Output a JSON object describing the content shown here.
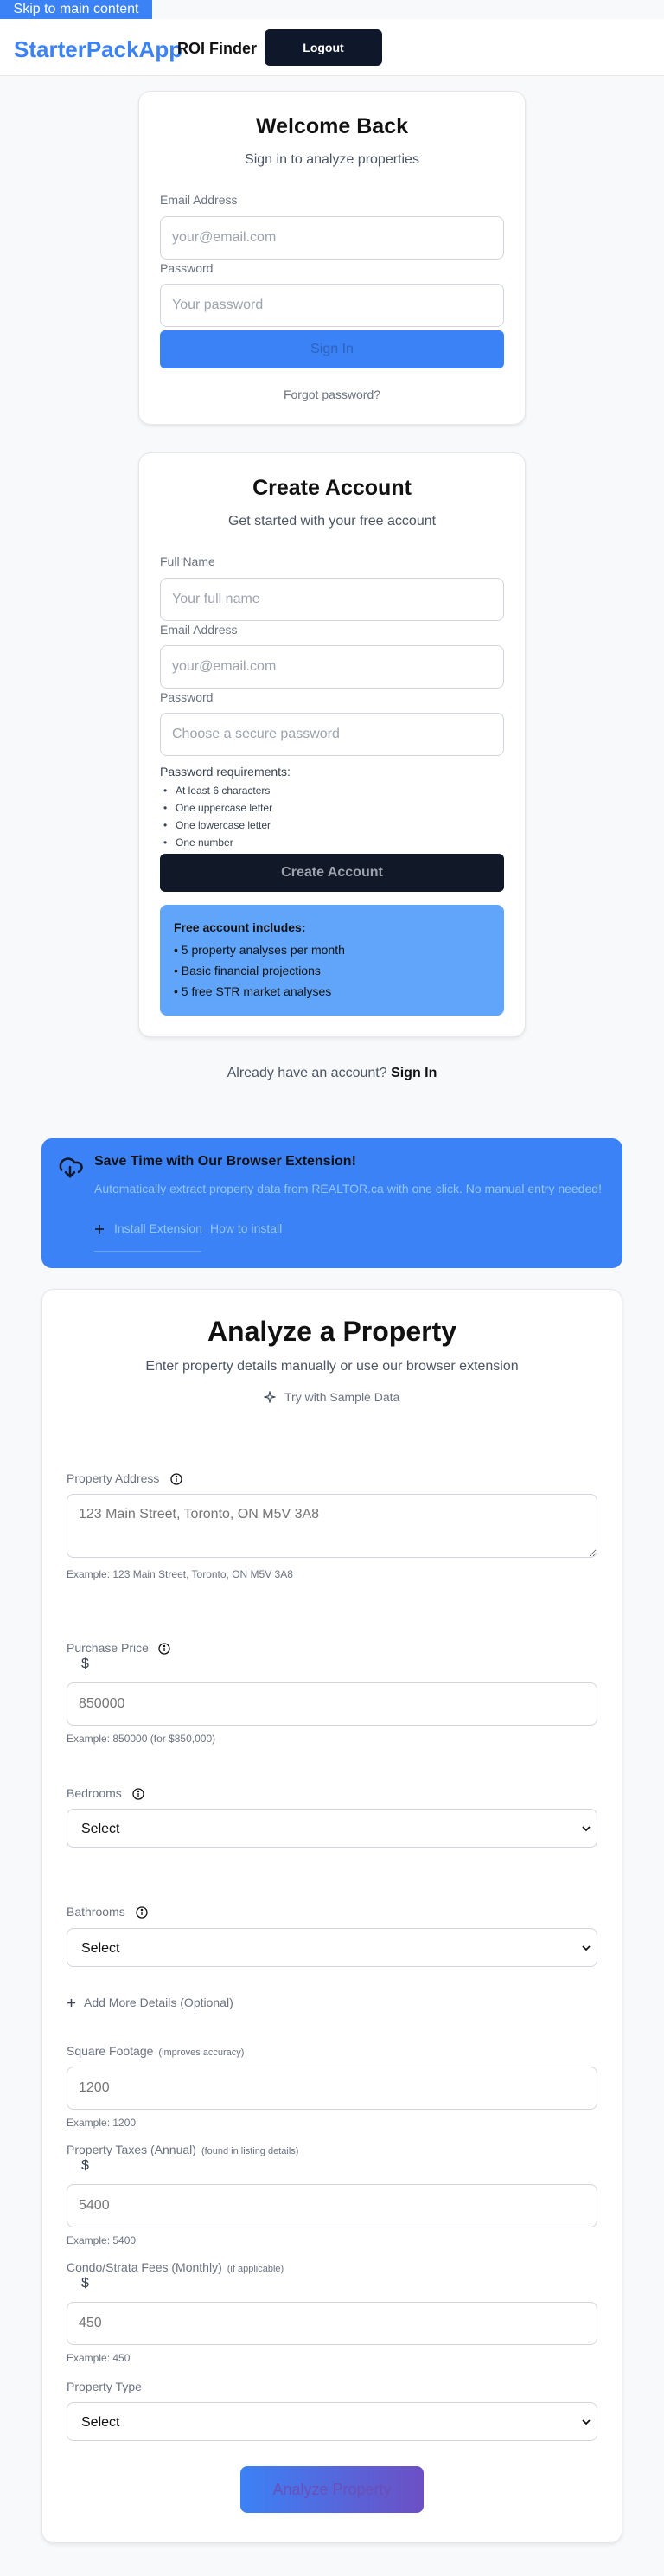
{
  "skip_link": "Skip to main content",
  "nav": {
    "brand": "StarterPackApp",
    "title": "ROI Finder",
    "logout": "Logout"
  },
  "login": {
    "title": "Welcome Back",
    "subtitle": "Sign in to analyze properties",
    "email_label": "Email Address",
    "email_placeholder": "your@email.com",
    "password_label": "Password",
    "password_placeholder": "Your password",
    "submit": "Sign In",
    "forgot": "Forgot password?"
  },
  "signup": {
    "title": "Create Account",
    "subtitle": "Get started with your free account",
    "name_label": "Full Name",
    "name_placeholder": "Your full name",
    "email_label": "Email Address",
    "email_placeholder": "your@email.com",
    "password_label": "Password",
    "password_placeholder": "Choose a secure password",
    "requirements_title": "Password requirements:",
    "requirements": [
      "At least 6 characters",
      "One uppercase letter",
      "One lowercase letter",
      "One number"
    ],
    "submit": "Create Account",
    "free_title": "Free account includes:",
    "free_items": [
      "• 5 property analyses per month",
      "• Basic financial projections",
      "• 5 free STR market analyses"
    ]
  },
  "already": {
    "text": "Already have an account?",
    "link": "Sign In"
  },
  "extension": {
    "title": "Save Time with Our Browser Extension!",
    "description": "Automatically extract property data from REALTOR.ca with one click. No manual entry needed!",
    "install": "Install Extension",
    "how": "How to install"
  },
  "analyze": {
    "title": "Analyze a Property",
    "subtitle": "Enter property details manually or use our browser extension",
    "sample": "Try with Sample Data",
    "address_label": "Property Address",
    "address_placeholder": "123 Main Street, Toronto, ON M5V 3A8",
    "address_example": "Example: 123 Main Street, Toronto, ON M5V 3A8",
    "price_label": "Purchase Price",
    "currency": "$",
    "price_placeholder": "850000",
    "price_example": "Example: 850000 (for $850,000)",
    "bedrooms_label": "Bedrooms",
    "bathrooms_label": "Bathrooms",
    "select_value": "Select",
    "add_more": "Add More Details (Optional)",
    "sqft_label": "Square Footage",
    "sqft_hint": "(improves accuracy)",
    "sqft_placeholder": "1200",
    "sqft_example": "Example: 1200",
    "tax_label": "Property Taxes (Annual)",
    "tax_hint": "(found in listing details)",
    "tax_placeholder": "5400",
    "tax_example": "Example: 5400",
    "condo_label": "Condo/Strata Fees (Monthly)",
    "condo_hint": "(if applicable)",
    "condo_placeholder": "450",
    "condo_example": "Example: 450",
    "type_label": "Property Type",
    "submit": "Analyze Property"
  },
  "colors": {
    "accent": "#3b82f6",
    "dark_button": "#111827",
    "free_box": "#60a5fa",
    "gradient_end": "#6d4fc4"
  }
}
